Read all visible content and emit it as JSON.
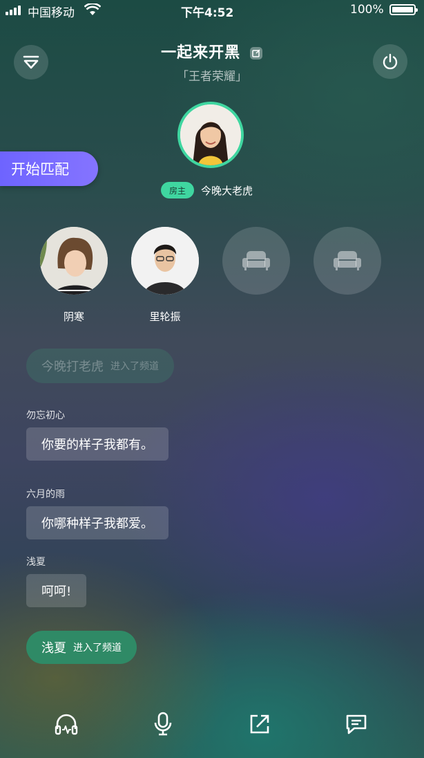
{
  "status_bar": {
    "carrier": "中国移动",
    "time": "下午4:52",
    "battery": "100%"
  },
  "header": {
    "title": "一起来开黑",
    "subtitle": "「王者荣耀」"
  },
  "match_button": {
    "label": "开始匹配"
  },
  "host": {
    "badge": "房主",
    "name": "今晚大老虎"
  },
  "seats": [
    {
      "name": "阴寒",
      "occupied": true
    },
    {
      "name": "里轮振",
      "occupied": true
    },
    {
      "name": "",
      "occupied": false
    },
    {
      "name": "",
      "occupied": false
    }
  ],
  "chat": {
    "system_top": {
      "name": "今晚打老虎",
      "text": "进入了频道"
    },
    "messages": [
      {
        "user": "勿忘初心",
        "text": "你要的样子我都有。"
      },
      {
        "user": "六月的雨",
        "text": "你哪种样子我都爱。"
      },
      {
        "user": "浅夏",
        "text": "呵呵!"
      }
    ],
    "system_bottom": {
      "name": "浅夏",
      "text": "进入了频道"
    }
  },
  "toolbar": {
    "icons": [
      "headphones-icon",
      "microphone-icon",
      "share-icon",
      "chat-icon"
    ]
  },
  "colors": {
    "accent_green": "#3fd6a0",
    "match_purple": "#7a6cff",
    "system_green": "#2f8a66"
  }
}
